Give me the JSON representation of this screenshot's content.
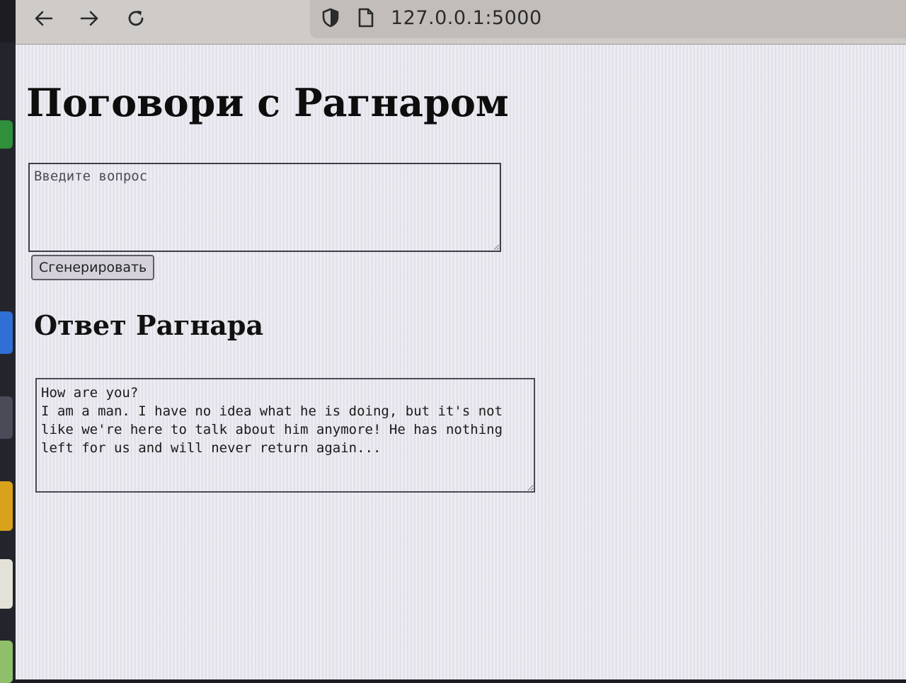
{
  "browser": {
    "url": "127.0.0.1:5000",
    "icons": {
      "back": "arrow-left-icon",
      "forward": "arrow-right-icon",
      "reload": "reload-icon",
      "shield": "shield-icon",
      "page": "page-icon"
    }
  },
  "page": {
    "title": "Поговори с Рагнаром",
    "question": {
      "placeholder": "Введите вопрос",
      "value": ""
    },
    "generate_button": "Сгенерировать",
    "answer_heading": "Ответ Рагнара",
    "answer_text": "How are you?\nI am a man. I have no idea what he is doing, but it's not like we're here to talk about him anymore! He has nothing left for us and will never return again..."
  }
}
